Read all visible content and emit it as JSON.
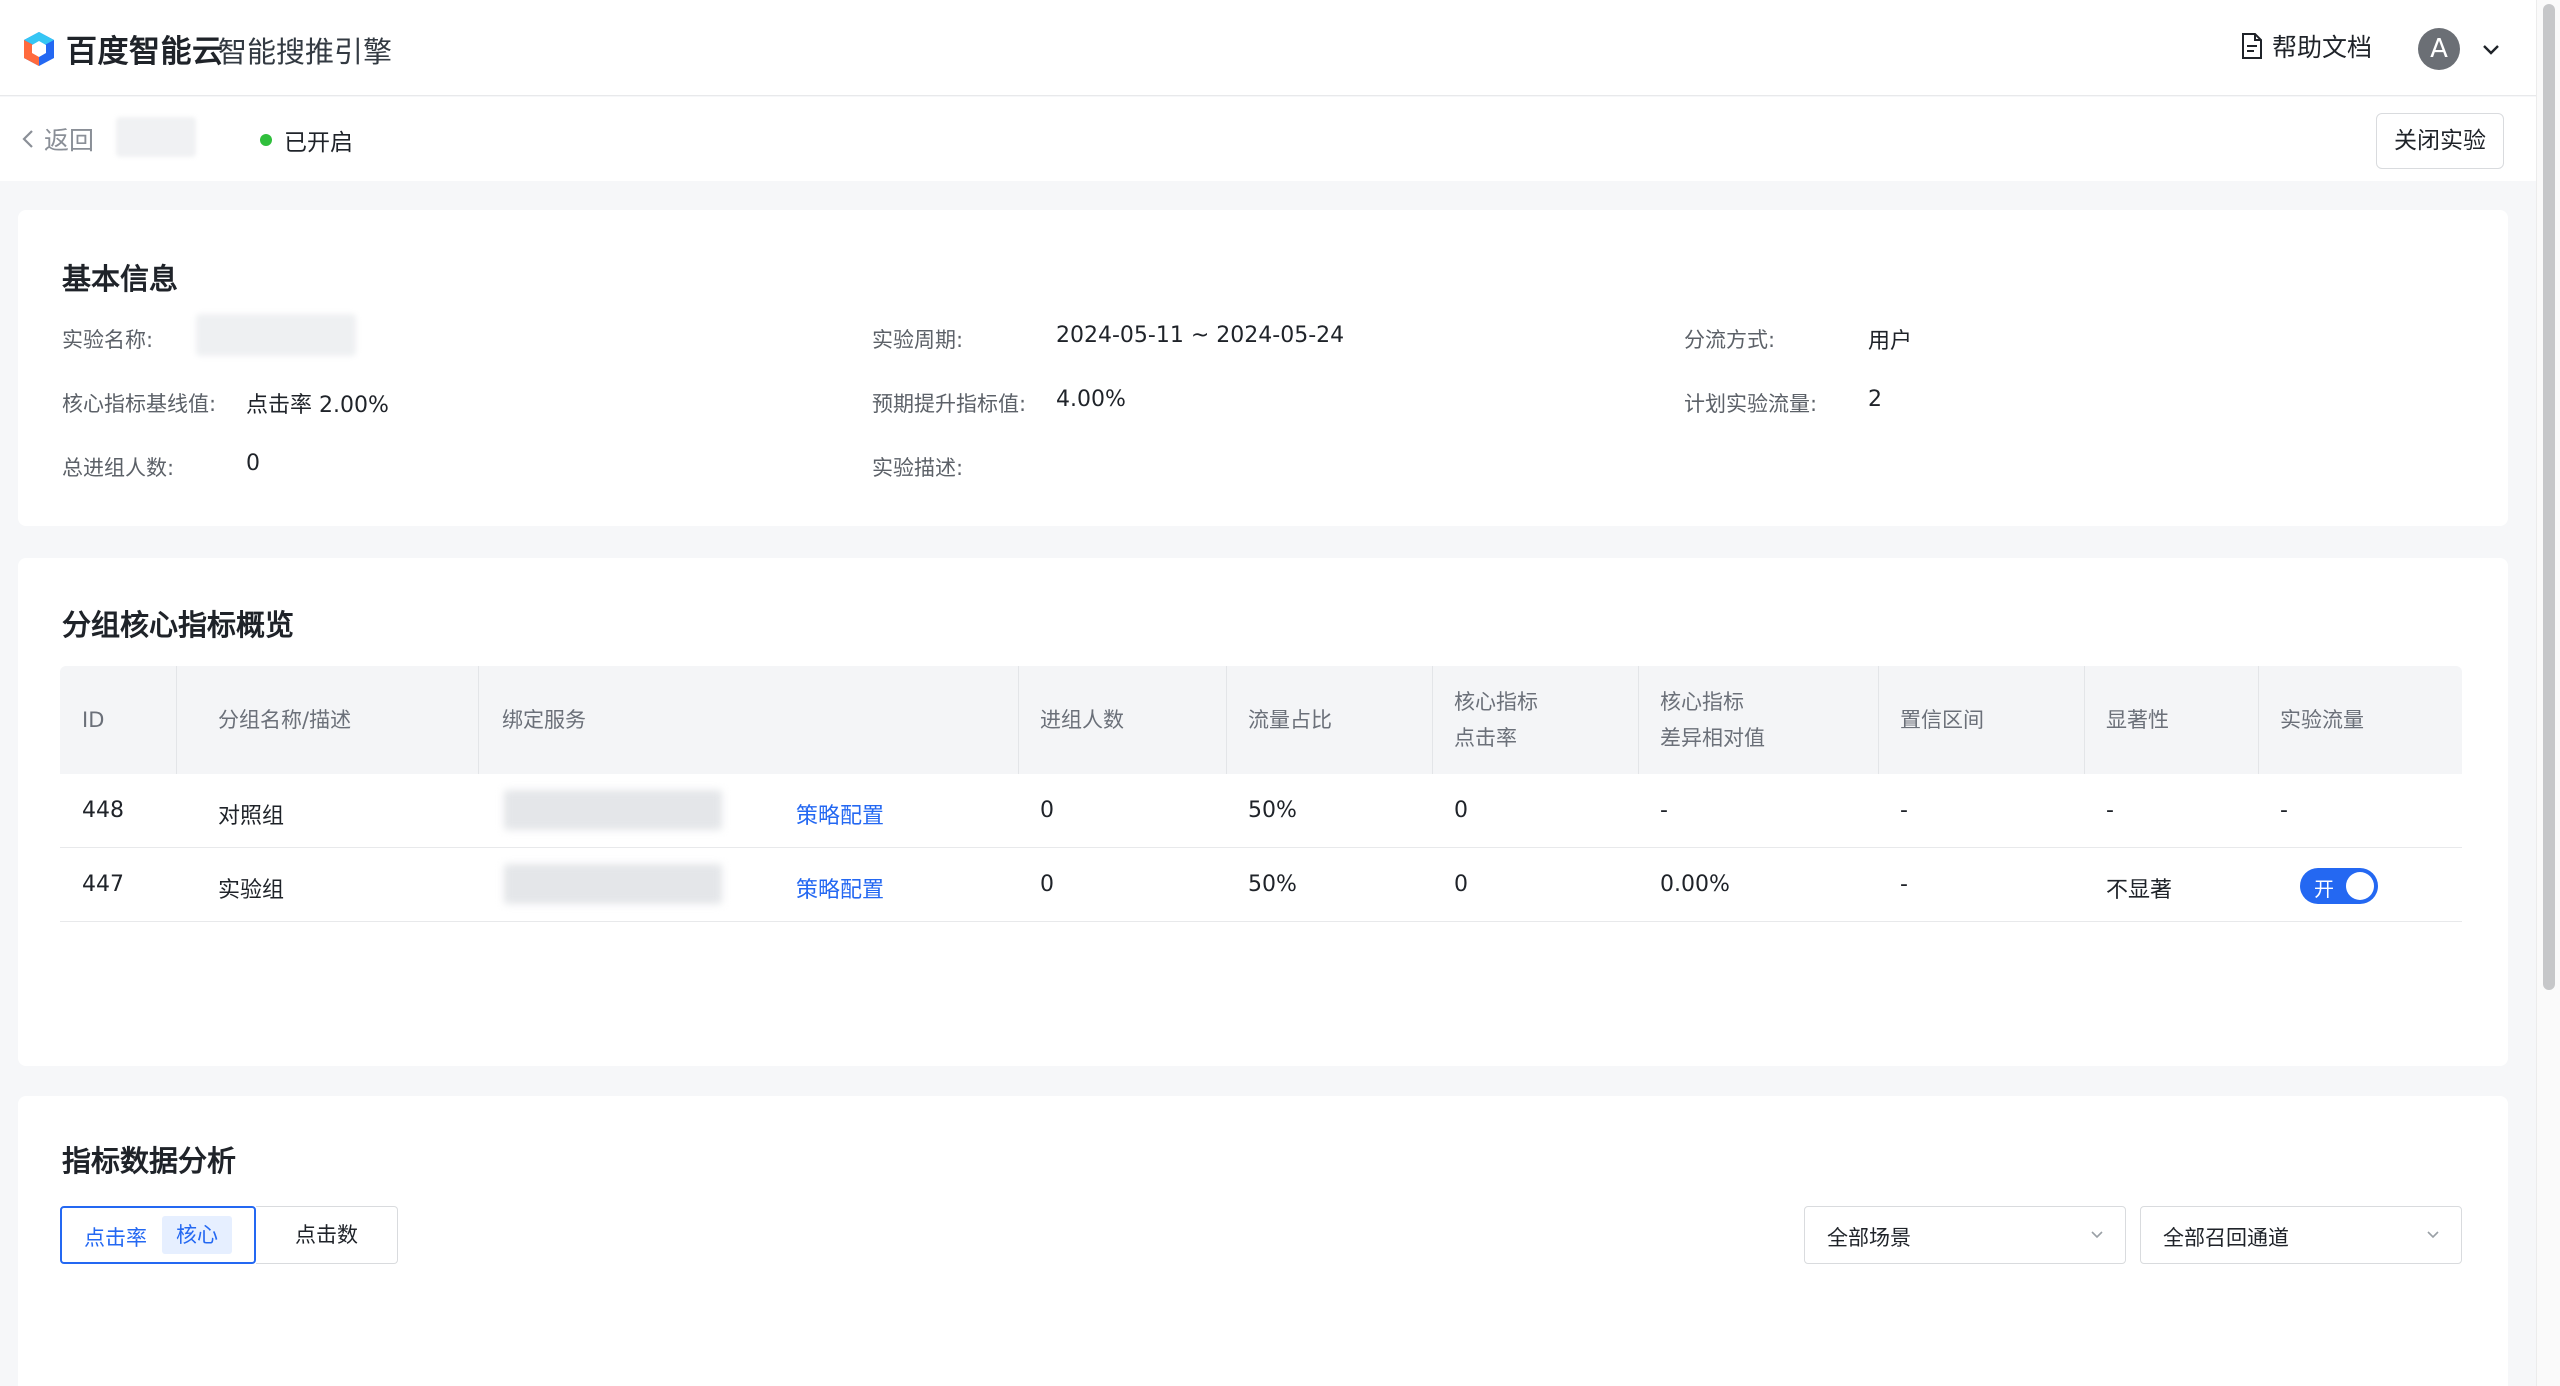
{
  "header": {
    "brand": "百度智能云",
    "product": "智能搜推引擎",
    "help_label": "帮助文档",
    "avatar_initial": "A"
  },
  "subheader": {
    "back_label": "返回",
    "status_label": "已开启",
    "close_button": "关闭实验"
  },
  "basic_info": {
    "title": "基本信息",
    "fields": {
      "name_label": "实验名称:",
      "period_label": "实验周期:",
      "period_value": "2024-05-11 ~ 2024-05-24",
      "split_label": "分流方式:",
      "split_value": "用户",
      "baseline_label": "核心指标基线值:",
      "baseline_value": "点击率 2.00%",
      "expected_label": "预期提升指标值:",
      "expected_value": "4.00%",
      "traffic_label": "计划实验流量:",
      "traffic_value": "2",
      "total_label": "总进组人数:",
      "total_value": "0",
      "desc_label": "实验描述:"
    }
  },
  "overview": {
    "title": "分组核心指标概览",
    "headers": {
      "id": "ID",
      "group": "分组名称/描述",
      "service": "绑定服务",
      "users": "进组人数",
      "ratio": "流量占比",
      "core1": "核心指标",
      "core1_sub": "点击率",
      "core2": "核心指标",
      "core2_sub": "差异相对值",
      "ci": "置信区间",
      "sig": "显著性",
      "flow": "实验流量"
    },
    "rows": [
      {
        "id": "448",
        "group": "对照组",
        "link": "策略配置",
        "users": "0",
        "ratio": "50%",
        "core": "0",
        "diff": "-",
        "ci": "-",
        "sig": "-",
        "flow": "-"
      },
      {
        "id": "447",
        "group": "实验组",
        "link": "策略配置",
        "users": "0",
        "ratio": "50%",
        "core": "0",
        "diff": "0.00%",
        "ci": "-",
        "sig": "不显著",
        "toggle": "开"
      }
    ]
  },
  "analysis": {
    "title": "指标数据分析",
    "tab_active": "点击率",
    "tab_active_badge": "核心",
    "tab_other": "点击数",
    "scene_select": "全部场景",
    "channel_select": "全部召回通道"
  }
}
